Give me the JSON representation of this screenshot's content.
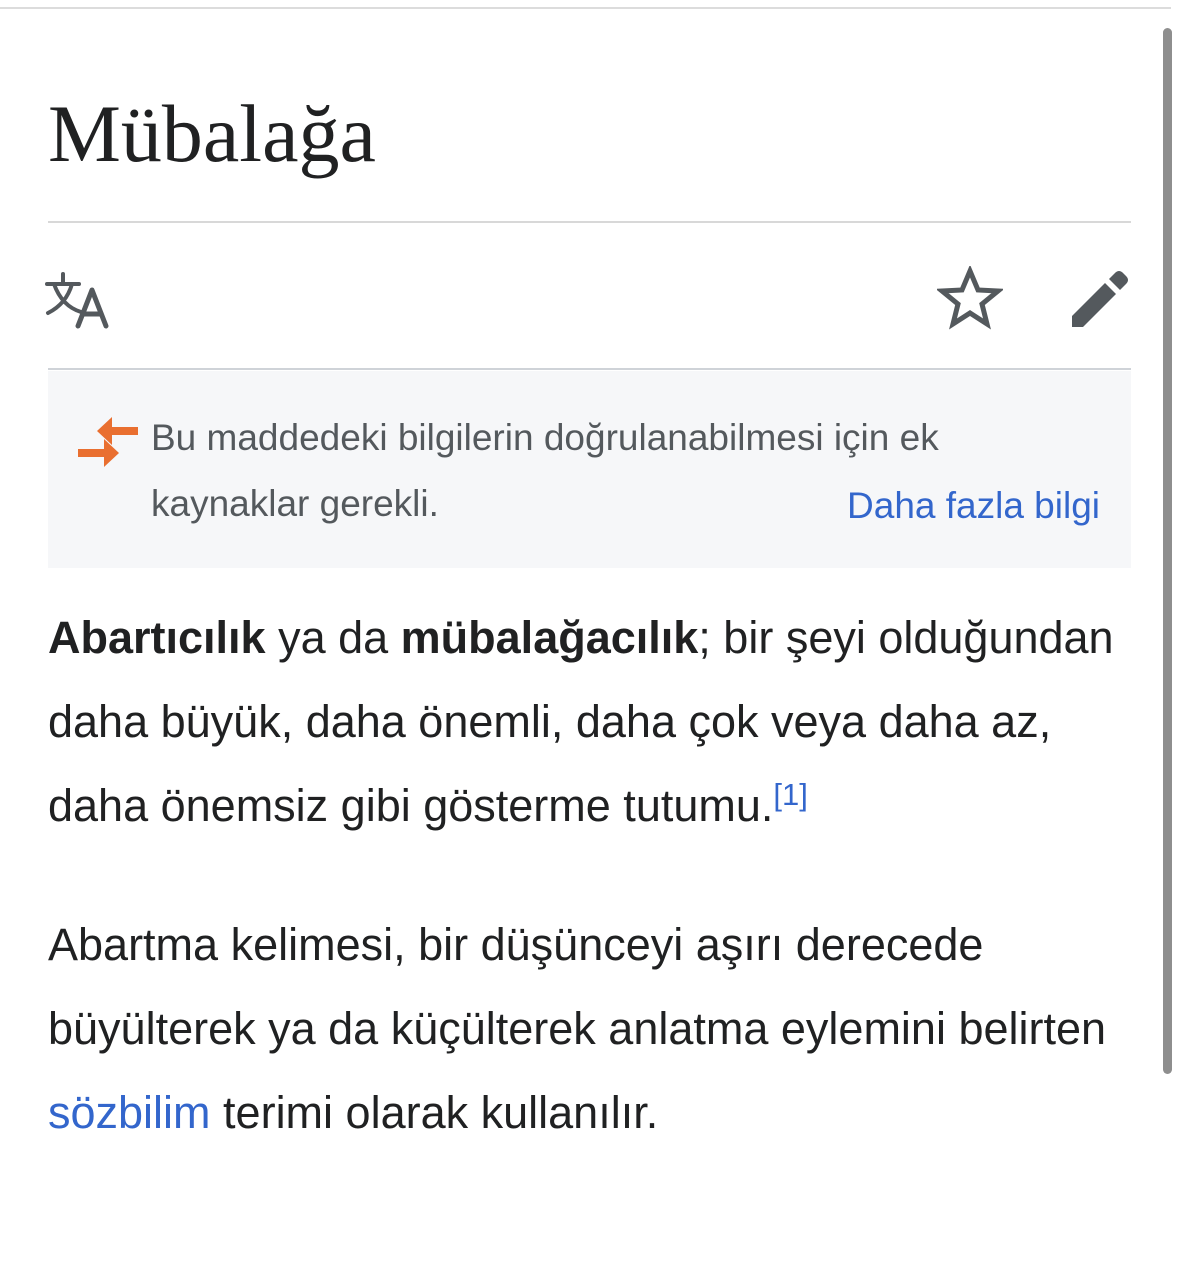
{
  "article": {
    "title": "Mübalağa"
  },
  "page_actions": {
    "language_icon": "translate-icon",
    "watch_icon": "star-icon",
    "edit_icon": "pencil-icon"
  },
  "notice": {
    "icon": "merge-arrows-icon",
    "text": "Bu maddedeki bilgilerin doğrulanabilmesi için ek kaynaklar gerekli.",
    "more_link": "Daha fazla bilgi",
    "accent_color": "#e96f30"
  },
  "content": {
    "p1": {
      "term1": "Abartıcılık",
      "connector": " ya da ",
      "term2": "mübalağacılık",
      "rest": "; bir şeyi olduğundan daha büyük, daha önemli, daha çok veya daha az, daha önemsiz gibi gösterme tutumu.",
      "ref": "[1]"
    },
    "p2": {
      "before": "Abartma kelimesi, bir düşünceyi aşırı derecede büyülterek ya da küçülterek anlatma eylemini belirten ",
      "link": "sözbilim",
      "after": " terimi olarak kullanılır."
    }
  },
  "colors": {
    "link": "#3366cc",
    "text": "#202122",
    "muted_text": "#54595d",
    "notice_background": "#f6f7f9",
    "icon": "#54595d"
  }
}
